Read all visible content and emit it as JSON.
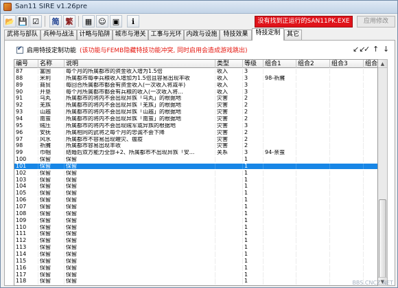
{
  "window": {
    "title": "San11 SIRE v1.26pre"
  },
  "toolbar": {
    "buttons": [
      {
        "name": "open-folder-icon",
        "glyph": "📂"
      },
      {
        "name": "save-disk-icon",
        "glyph": "💾"
      },
      {
        "name": "settings-sheet-icon",
        "glyph": "☑"
      }
    ],
    "simplified_label": "简",
    "traditional_label": "繁",
    "extra_buttons": [
      {
        "name": "grid-icon",
        "glyph": "▦"
      },
      {
        "name": "character-face-icon",
        "glyph": "☺"
      },
      {
        "name": "floppy-icon",
        "glyph": "▣"
      },
      {
        "name": "info-icon",
        "glyph": "ℹ"
      }
    ],
    "warning_text": "没有找到正运行的SAN11PK.EXE",
    "apply_label": "应用修改"
  },
  "tabs": [
    "武将与部队",
    "兵种与战法",
    "计略与陷阱",
    "城市与港关",
    "工事与光环",
    "内政与设施",
    "特技效果",
    "特技定制",
    "其它"
  ],
  "active_tab_index": 7,
  "panel": {
    "enable_checked": true,
    "enable_label": "启用特技定制功能",
    "enable_note": "(该功能与FEMB隐藏特技功能冲突, 同时启用会造成游戏跳出)",
    "tool_glyphs": [
      "↙↙",
      "✓",
      "↑",
      "↓"
    ]
  },
  "table": {
    "columns": [
      "编号",
      "名称",
      "说明",
      "类型",
      "等级",
      "组合1",
      "组合2",
      "组合3",
      "组合4"
    ],
    "rows": [
      [
        "87",
        "富国",
        "每个月的所属都市的资金收入增为1.5倍",
        "收入",
        "3",
        "",
        "",
        "",
        ""
      ],
      [
        "88",
        "米利",
        "所属都市每季兵粮收入增加为1.5倍且容易出现丰收",
        "收入",
        "3",
        "98-祈臃",
        "",
        "",
        ""
      ],
      [
        "89",
        "商贸",
        "每回合所属都市都会有资金收入(一次收入将减半)",
        "收入",
        "3",
        "",
        "",
        "",
        ""
      ],
      [
        "90",
        "开垦",
        "每个月所属都市都会有兵粮的收入(一次收入将...",
        "收入",
        "3",
        "",
        "",
        "",
        ""
      ],
      [
        "91",
        "乌丸",
        "所属都市的将内不会出现异族「乌丸」的根据地",
        "灾害",
        "2",
        "",
        "",
        "",
        ""
      ],
      [
        "92",
        "羌族",
        "所属都市的将内不会出现异族「羌族」的根据地",
        "灾害",
        "2",
        "",
        "",
        "",
        ""
      ],
      [
        "93",
        "山越",
        "所属都市的将内不会出现异族「山越」的根据地",
        "灾害",
        "2",
        "",
        "",
        "",
        ""
      ],
      [
        "94",
        "南蛮",
        "所属都市的将内不会出现异族「南蛮」的根据地",
        "灾害",
        "2",
        "",
        "",
        "",
        ""
      ],
      [
        "95",
        "贼压",
        "所属都市的将内不会出现贼军或异族的根据地",
        "灾害",
        "3",
        "",
        "",
        "",
        ""
      ],
      [
        "96",
        "安抚",
        "所属相同的武将之每个月的忠诚不会下降",
        "灾害",
        "2",
        "",
        "",
        "",
        ""
      ],
      [
        "97",
        "风水",
        "所属都市不容易出现蝗灾、瘟疫",
        "灾害",
        "2",
        "",
        "",
        "",
        ""
      ],
      [
        "98",
        "祈臃",
        "所属都市容易出现丰收",
        "灾害",
        "2",
        "",
        "",
        "",
        ""
      ],
      [
        "99",
        "巾帼",
        "结婚后双方能力全部+2、所属都市不出现异族「安...",
        "关系",
        "3",
        "94-亲蛮",
        "",
        "",
        ""
      ],
      [
        "100",
        "保留",
        "保留",
        "",
        "1",
        "",
        "",
        "",
        ""
      ],
      [
        "101",
        "保留",
        "保留",
        "",
        "1",
        "",
        "",
        "",
        ""
      ],
      [
        "102",
        "保留",
        "保留",
        "",
        "1",
        "",
        "",
        "",
        ""
      ],
      [
        "103",
        "保留",
        "保留",
        "",
        "1",
        "",
        "",
        "",
        ""
      ],
      [
        "104",
        "保留",
        "保留",
        "",
        "1",
        "",
        "",
        "",
        ""
      ],
      [
        "105",
        "保留",
        "保留",
        "",
        "1",
        "",
        "",
        "",
        ""
      ],
      [
        "106",
        "保留",
        "保留",
        "",
        "1",
        "",
        "",
        "",
        ""
      ],
      [
        "107",
        "保留",
        "保留",
        "",
        "1",
        "",
        "",
        "",
        ""
      ],
      [
        "108",
        "保留",
        "保留",
        "",
        "1",
        "",
        "",
        "",
        ""
      ],
      [
        "109",
        "保留",
        "保留",
        "",
        "1",
        "",
        "",
        "",
        ""
      ],
      [
        "110",
        "保留",
        "保留",
        "",
        "1",
        "",
        "",
        "",
        ""
      ],
      [
        "111",
        "保留",
        "保留",
        "",
        "1",
        "",
        "",
        "",
        ""
      ],
      [
        "112",
        "保留",
        "保留",
        "",
        "1",
        "",
        "",
        "",
        ""
      ],
      [
        "113",
        "保留",
        "保留",
        "",
        "1",
        "",
        "",
        "",
        ""
      ],
      [
        "114",
        "保留",
        "保留",
        "",
        "1",
        "",
        "",
        "",
        ""
      ],
      [
        "115",
        "保留",
        "保留",
        "",
        "1",
        "",
        "",
        "",
        ""
      ],
      [
        "116",
        "保留",
        "保留",
        "",
        "1",
        "",
        "",
        "",
        ""
      ],
      [
        "117",
        "保留",
        "保留",
        "",
        "1",
        "",
        "",
        "",
        ""
      ],
      [
        "118",
        "保留",
        "保留",
        "",
        "1",
        "",
        "",
        "",
        ""
      ]
    ],
    "selected_row_index": 14
  },
  "colors": {
    "selection": "#1786e6",
    "warning_bg": "#e0131a",
    "note_text": "#e5170f"
  },
  "watermark": "BBS.CNCZ.NET"
}
